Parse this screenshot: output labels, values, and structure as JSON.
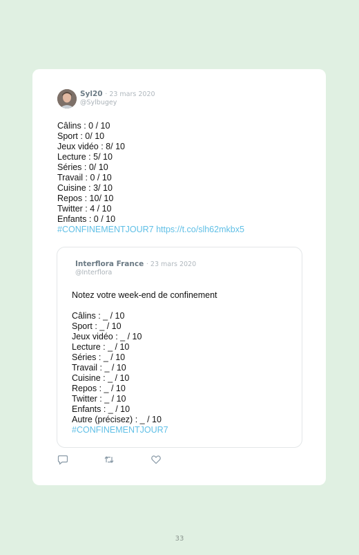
{
  "tweet": {
    "author_name": "Syl20",
    "date": "· 23 mars 2020",
    "handle": "@Sylbugey",
    "lines": [
      "Câlins : 0 / 10",
      "Sport : 0/ 10",
      "Jeux vidéo : 8/ 10",
      "Lecture : 5/ 10",
      "Séries : 0/ 10",
      "Travail : 0 / 10",
      "Cuisine : 3/ 10",
      "Repos : 10/ 10",
      "Twitter : 4 / 10",
      "Enfants : 0 / 10"
    ],
    "link_line": "#CONFINEMENTJOUR7 https://t.co/slh62mkbx5"
  },
  "quoted": {
    "author_name": "Interflora France",
    "date": "· 23 mars 2020",
    "handle": "@Interflora",
    "intro": "Notez votre week-end de confinement",
    "lines": [
      "Câlins : _ / 10",
      "Sport : _ / 10",
      "Jeux vidéo : _ / 10",
      "Lecture : _ / 10",
      "Séries : _ / 10",
      "Travail : _ / 10",
      "Cuisine : _ / 10",
      "Repos : _ / 10",
      "Twitter : _ / 10",
      "Enfants : _ / 10",
      "Autre (précisez) : _ / 10"
    ],
    "hashtag": "#CONFINEMENTJOUR7"
  },
  "actions": {
    "reply_icon": "reply-icon",
    "retweet_icon": "retweet-icon",
    "like_icon": "heart-icon"
  },
  "colors": {
    "background": "#e0f0e2",
    "link": "#5fbfe6"
  },
  "page_number": "33"
}
